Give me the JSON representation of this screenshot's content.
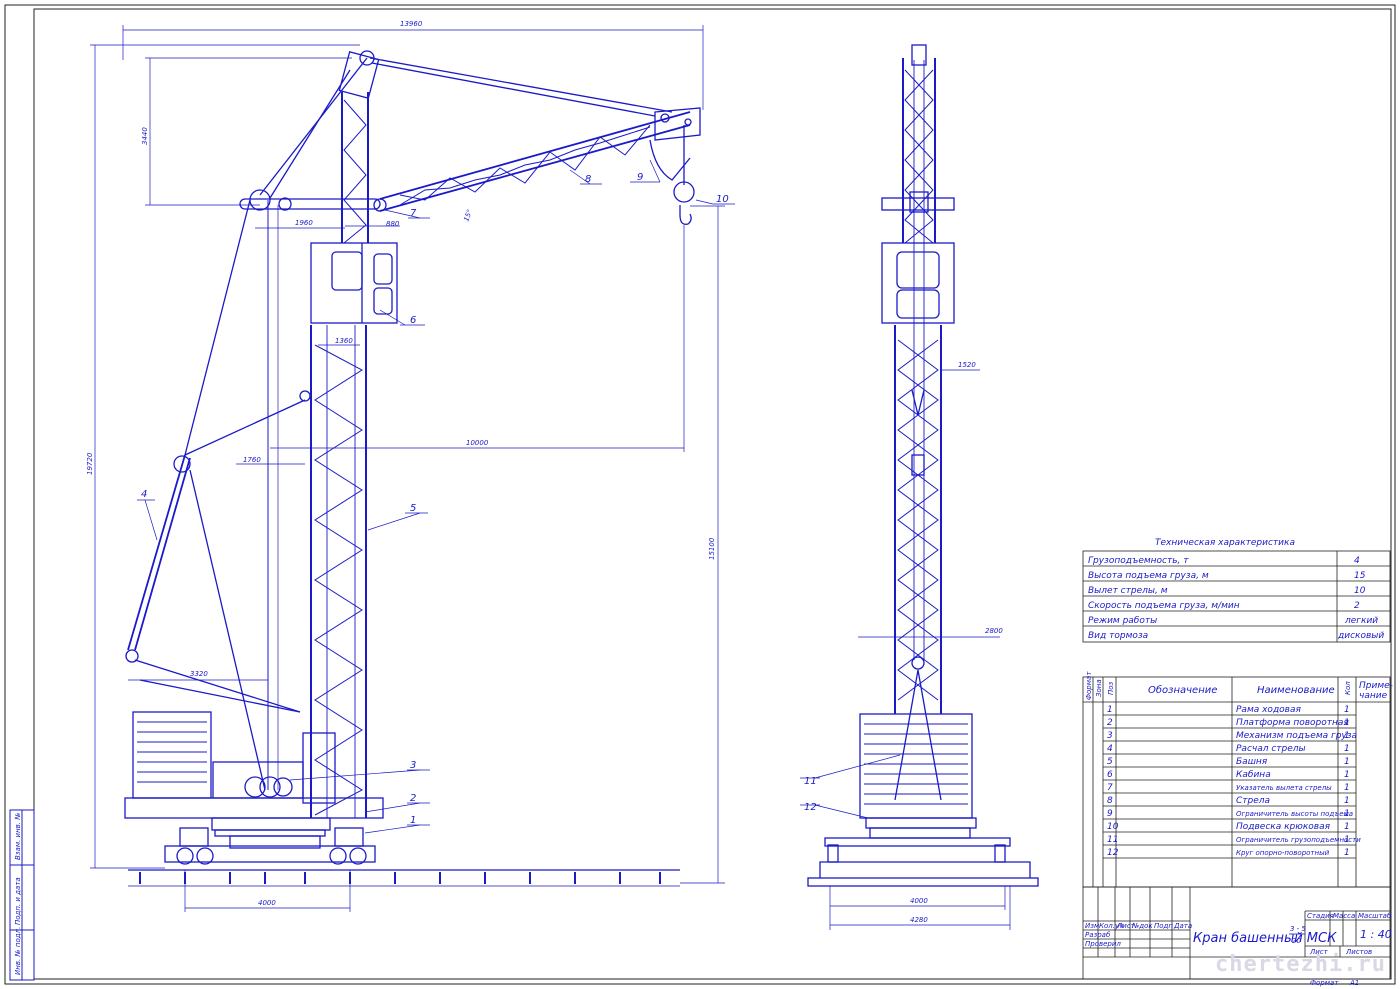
{
  "colors": {
    "line": "#1a1ac8",
    "paper": "#ffffff",
    "frame": "#222222",
    "watermark": "#d8d8e6"
  },
  "dims": {
    "overall_width": "13960",
    "overall_height": "19720",
    "boom_rise": "3440",
    "d1960": "1960",
    "d880": "880",
    "angle": "15°",
    "d1360": "1360",
    "reach": "10000",
    "d1760": "1760",
    "d3320": "3320",
    "hook_height": "15100",
    "track": "4000",
    "side_1520": "1520",
    "side_2800": "2800",
    "side_4000": "4000",
    "side_4280": "4280"
  },
  "callouts": [
    "1",
    "2",
    "3",
    "4",
    "5",
    "6",
    "7",
    "8",
    "9",
    "10",
    "11",
    "12"
  ],
  "tech": {
    "title": "Техническая характеристика",
    "rows": [
      {
        "name": "Грузоподъемность, т",
        "value": "4"
      },
      {
        "name": "Высота подъема груза, м",
        "value": "15"
      },
      {
        "name": "Вылет стрелы, м",
        "value": "10"
      },
      {
        "name": "Скорость подъема груза, м/мин",
        "value": "2"
      },
      {
        "name": "Режим работы",
        "value": "легкий"
      },
      {
        "name": "Вид тормоза",
        "value": "дисковый"
      }
    ]
  },
  "spec": {
    "headers": {
      "format": "Формат",
      "zone": "Зона",
      "pos": "Поз",
      "designation": "Обозначение",
      "name": "Наименование",
      "qty": "Кол",
      "note1": "Приме-",
      "note2": "чание"
    },
    "rows": [
      {
        "pos": "1",
        "name": "Рама ходовая",
        "qty": "1"
      },
      {
        "pos": "2",
        "name": "Платформа поворотная",
        "qty": "1"
      },
      {
        "pos": "3",
        "name": "Механизм подъема груза",
        "qty": "1"
      },
      {
        "pos": "4",
        "name": "Расчал стрелы",
        "qty": "1"
      },
      {
        "pos": "5",
        "name": "Башня",
        "qty": "1"
      },
      {
        "pos": "6",
        "name": "Кабина",
        "qty": "1"
      },
      {
        "pos": "7",
        "name": "Указатель вылета стрелы",
        "qty": "1"
      },
      {
        "pos": "8",
        "name": "Стрела",
        "qty": "1"
      },
      {
        "pos": "9",
        "name": "Ограничитель высоты подъема",
        "qty": "1"
      },
      {
        "pos": "10",
        "name": "Подвеска крюковая",
        "qty": "1"
      },
      {
        "pos": "11",
        "name": "Ограничитель грузоподъемности",
        "qty": "1"
      },
      {
        "pos": "12",
        "name": "Круг опорно-поворотный",
        "qty": "1"
      }
    ]
  },
  "title_block": {
    "title_main": "Кран башенный МСК",
    "frac_top": "3 - 5",
    "frac_bottom": "20",
    "stage": "Стадия",
    "mass": "Масса",
    "scale_label": "Масштаб",
    "scale": "1 : 40",
    "sheet": "Лист",
    "sheets": "Листов",
    "izm": "Изм",
    "kol": "Кол.уч",
    "list": "Лист",
    "ndok": "№док",
    "podp": "Подп",
    "data": "Дата",
    "razrab": "Разраб",
    "prover": "Проверил",
    "format": "Формат",
    "format_value": "A1"
  },
  "left_strip": [
    "Инв. № подл.",
    "Подп. и дата",
    "Взам. инв. №"
  ],
  "watermark": "chertezhi.ru"
}
